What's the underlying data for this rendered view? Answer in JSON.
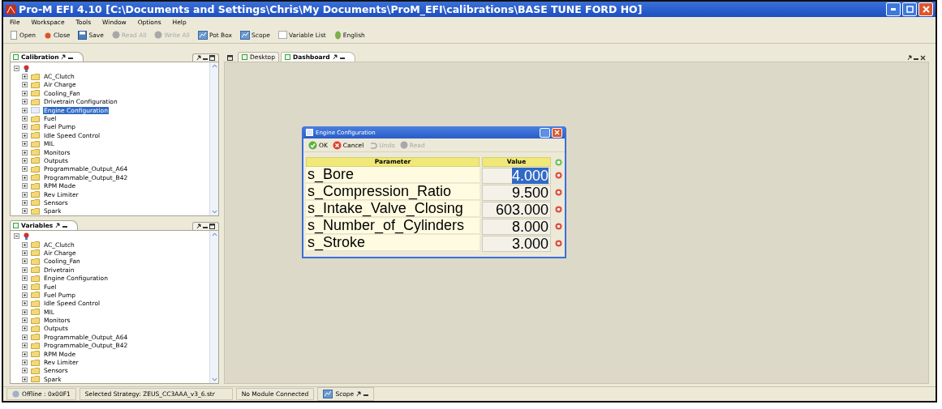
{
  "window": {
    "title": "Pro-M EFI 4.10 [C:\\Documents and Settings\\Chris\\My Documents\\ProM_EFI\\calibrations\\BASE TUNE FORD HO]"
  },
  "menu": [
    "File",
    "Workspace",
    "Tools",
    "Window",
    "Options",
    "Help"
  ],
  "toolbar": [
    {
      "label": "Open",
      "disabled": false
    },
    {
      "label": "Close",
      "disabled": false
    },
    {
      "label": "Save",
      "disabled": false
    },
    {
      "label": "Read All",
      "disabled": true
    },
    {
      "label": "Write All",
      "disabled": true
    },
    {
      "label": "Pot Box",
      "disabled": false
    },
    {
      "label": "Scope",
      "disabled": false
    },
    {
      "label": "Variable List",
      "disabled": false
    },
    {
      "label": "English",
      "disabled": false
    }
  ],
  "calibration": {
    "title": "Calibration",
    "items": [
      {
        "label": "AC_Clutch",
        "selected": false
      },
      {
        "label": "Air Charge",
        "selected": false
      },
      {
        "label": "Cooling_Fan",
        "selected": false
      },
      {
        "label": "Drivetrain Configuration",
        "selected": false
      },
      {
        "label": "Engine Configuration",
        "selected": true
      },
      {
        "label": "Fuel",
        "selected": false
      },
      {
        "label": "Fuel Pump",
        "selected": false
      },
      {
        "label": "Idle Speed Control",
        "selected": false
      },
      {
        "label": "MIL",
        "selected": false
      },
      {
        "label": "Monitors",
        "selected": false
      },
      {
        "label": "Outputs",
        "selected": false
      },
      {
        "label": "Programmable_Output_A64",
        "selected": false
      },
      {
        "label": "Programmable_Output_B42",
        "selected": false
      },
      {
        "label": "RPM Mode",
        "selected": false
      },
      {
        "label": "Rev Limiter",
        "selected": false
      },
      {
        "label": "Sensors",
        "selected": false
      },
      {
        "label": "Spark",
        "selected": false
      }
    ]
  },
  "variables": {
    "title": "Variables",
    "items": [
      {
        "label": "AC_Clutch",
        "selected": false
      },
      {
        "label": "Air Charge",
        "selected": false
      },
      {
        "label": "Cooling_Fan",
        "selected": false
      },
      {
        "label": "Drivetrain",
        "selected": false
      },
      {
        "label": "Engine Configuration",
        "selected": false
      },
      {
        "label": "Fuel",
        "selected": false
      },
      {
        "label": "Fuel Pump",
        "selected": false
      },
      {
        "label": "Idle Speed Control",
        "selected": false
      },
      {
        "label": "MIL",
        "selected": false
      },
      {
        "label": "Monitors",
        "selected": false
      },
      {
        "label": "Outputs",
        "selected": false
      },
      {
        "label": "Programmable_Output_A64",
        "selected": false
      },
      {
        "label": "Programmable_Output_B42",
        "selected": false
      },
      {
        "label": "RPM Mode",
        "selected": false
      },
      {
        "label": "Rev Limiter",
        "selected": false
      },
      {
        "label": "Sensors",
        "selected": false
      },
      {
        "label": "Spark",
        "selected": false
      }
    ]
  },
  "tabs": [
    {
      "label": "Desktop",
      "selected": false
    },
    {
      "label": "Dashboard",
      "selected": true
    }
  ],
  "dialog": {
    "title": "Engine Configuration",
    "toolbar": [
      {
        "label": "OK",
        "disabled": false
      },
      {
        "label": "Cancel",
        "disabled": false
      },
      {
        "label": "Undo",
        "disabled": true
      },
      {
        "label": "Read",
        "disabled": true
      }
    ],
    "columns": [
      "Parameter",
      "Value"
    ],
    "rows": [
      {
        "parameter": "s_Bore",
        "value": "4.000",
        "selected": true
      },
      {
        "parameter": "s_Compression_Ratio",
        "value": "9.500",
        "selected": false
      },
      {
        "parameter": "s_Intake_Valve_Closing",
        "value": "603.000",
        "selected": false
      },
      {
        "parameter": "s_Number_of_Cylinders",
        "value": "8.000",
        "selected": false
      },
      {
        "parameter": "s_Stroke",
        "value": "3.000",
        "selected": false
      }
    ]
  },
  "status_bar": {
    "connection": "Offline : 0x00F1",
    "strategy": "Selected Strategy: ZEUS_CC3AAA_v3_6.str",
    "module": "No Module Connected",
    "scope_tab": "Scope"
  }
}
